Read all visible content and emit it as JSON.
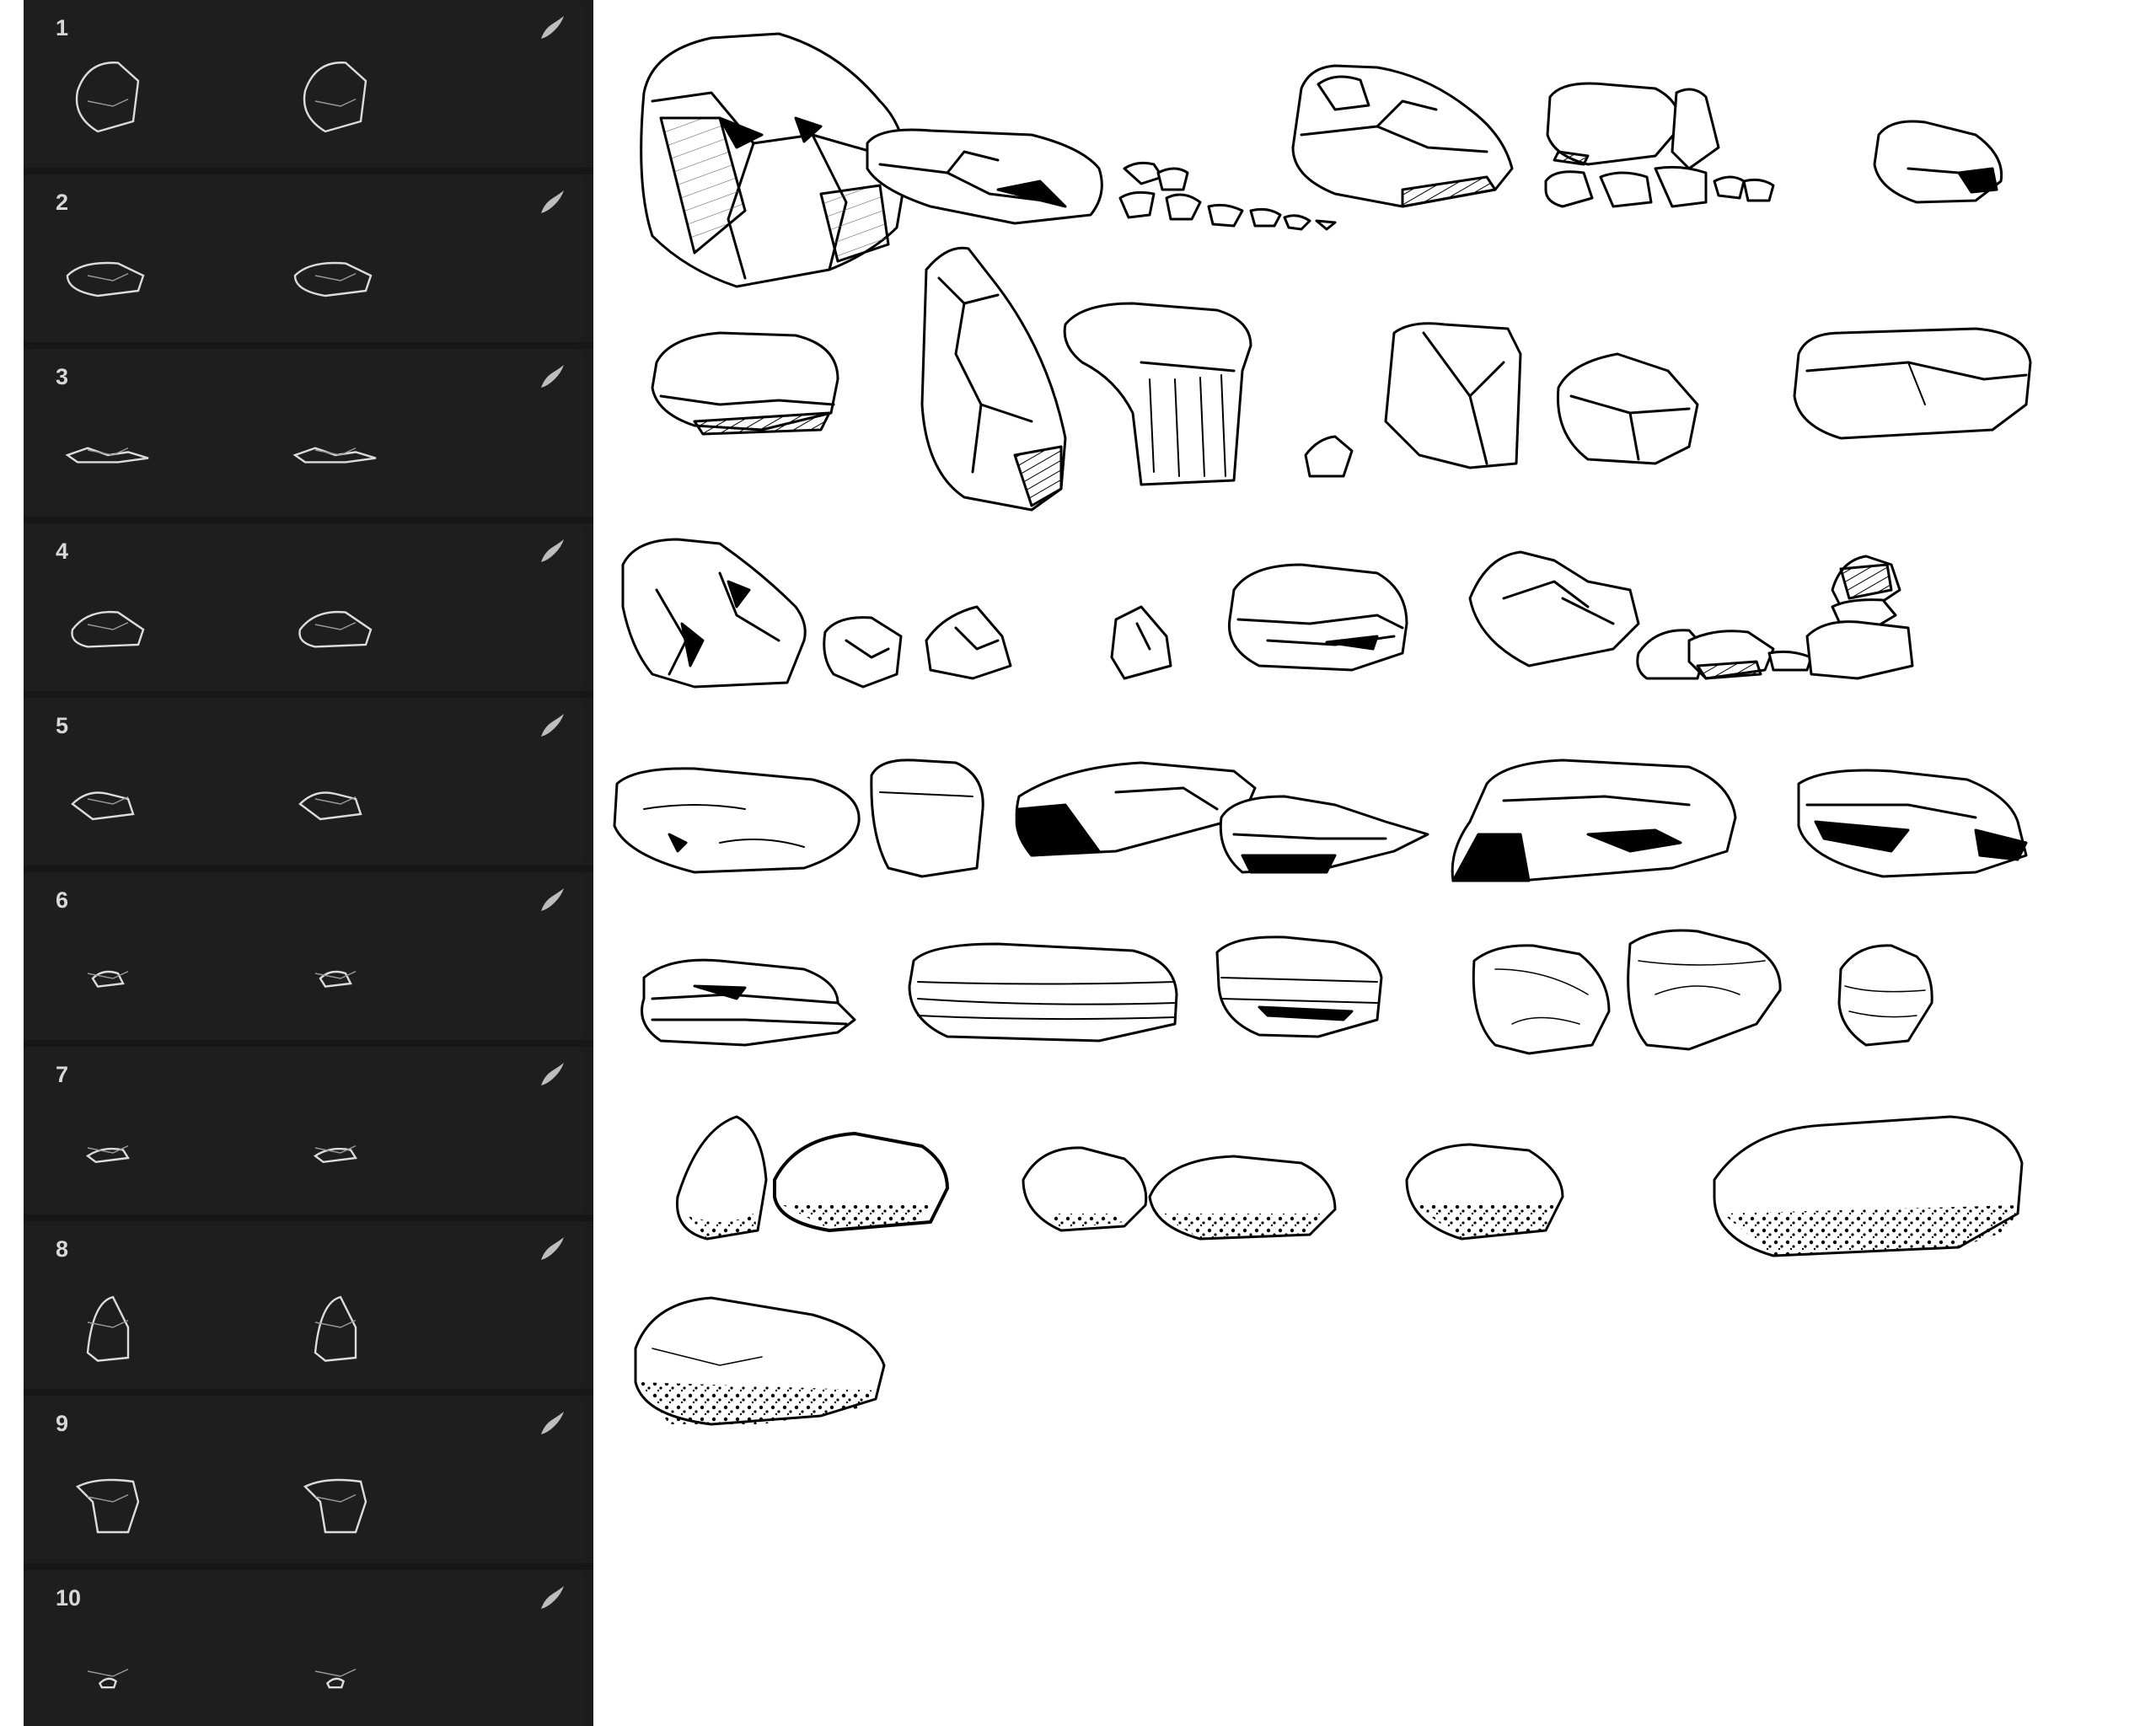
{
  "panel": {
    "background": "#1c1c1c",
    "text_color": "#d8d8d8",
    "brushes": [
      {
        "number": "1",
        "icon": "brush-stroke-icon",
        "preview": "rock-cluster-large"
      },
      {
        "number": "2",
        "icon": "brush-stroke-icon",
        "preview": "rock-flat-slab"
      },
      {
        "number": "3",
        "icon": "brush-stroke-icon",
        "preview": "rock-pebble-scatter"
      },
      {
        "number": "4",
        "icon": "brush-stroke-icon",
        "preview": "rock-layered-boulder"
      },
      {
        "number": "5",
        "icon": "brush-stroke-icon",
        "preview": "rock-pile"
      },
      {
        "number": "6",
        "icon": "brush-stroke-icon",
        "preview": "rock-small"
      },
      {
        "number": "7",
        "icon": "brush-stroke-icon",
        "preview": "rock-flat-small"
      },
      {
        "number": "8",
        "icon": "brush-stroke-icon",
        "preview": "rock-tall-shard"
      },
      {
        "number": "9",
        "icon": "brush-stroke-icon",
        "preview": "rock-stump"
      },
      {
        "number": "10",
        "icon": "brush-stroke-icon",
        "preview": "rock-tiny"
      }
    ]
  },
  "canvas": {
    "background": "#ffffff",
    "ink_color": "#000000",
    "subject": "rock-and-stone-line-art-sheet"
  }
}
